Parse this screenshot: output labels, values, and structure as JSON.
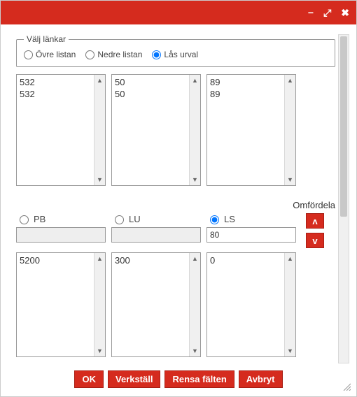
{
  "titlebar": {
    "minimize": "−",
    "maximize": "⤢",
    "close": "✖"
  },
  "radiogroup": {
    "legend": "Välj länkar",
    "opt_upper": "Övre listan",
    "opt_lower": "Nedre listan",
    "opt_lock": "Lås urval"
  },
  "upper_lists": {
    "c1": [
      "532",
      "532"
    ],
    "c2": [
      "50",
      "50"
    ],
    "c3": [
      "89",
      "89"
    ]
  },
  "omfordela_label": "Omfördela",
  "mid": {
    "pb": {
      "label": "PB",
      "value": ""
    },
    "lu": {
      "label": "LU",
      "value": ""
    },
    "ls": {
      "label": "LS",
      "value": "80"
    }
  },
  "side_buttons": {
    "up": "ʌ",
    "down": "v"
  },
  "lower_lists": {
    "c1": [
      "5200"
    ],
    "c2": [
      "300"
    ],
    "c3": [
      "0"
    ]
  },
  "footer": {
    "ok": "OK",
    "apply": "Verkställ",
    "clear": "Rensa fälten",
    "cancel": "Avbryt"
  }
}
